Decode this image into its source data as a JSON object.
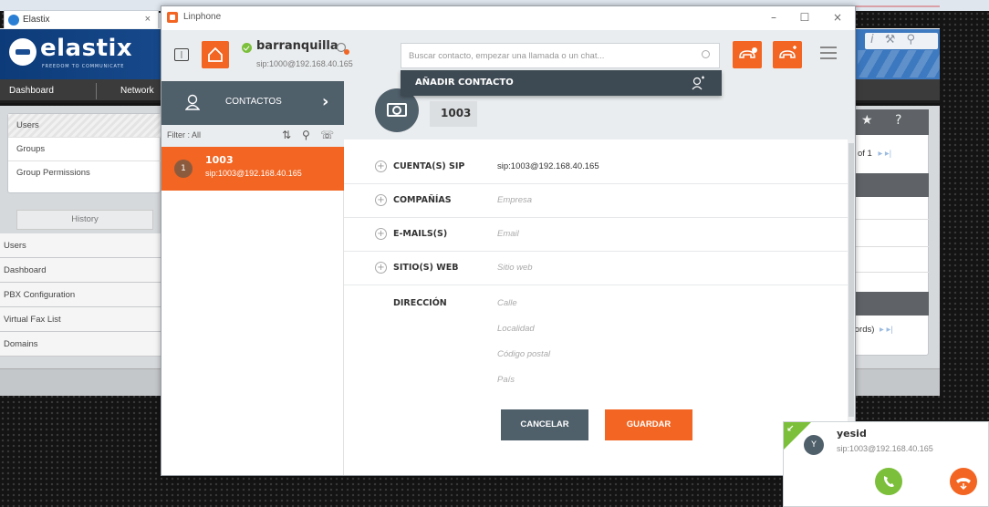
{
  "browser": {
    "tab_title": "Elastix",
    "tab_close": "×"
  },
  "elastix": {
    "logo_text": "elastix",
    "logo_tagline": "FREEDOM TO COMMUNICATE",
    "nav": [
      "Dashboard",
      "Network"
    ],
    "left_menu": [
      "Users",
      "Groups",
      "Group Permissions"
    ],
    "history_label": "History",
    "history_items": [
      "Users",
      "Dashboard",
      "PBX Configuration",
      "Virtual Fax List",
      "Domains"
    ],
    "pager_text": "of 1",
    "records_text": "cords)"
  },
  "linphone": {
    "window_title": "Linphone",
    "user": {
      "name": "barranquilla",
      "sip": "sip:1000@192.168.40.165"
    },
    "search_placeholder": "Buscar contacto, empezar una llamada o un chat...",
    "dropdown_label": "AÑADIR CONTACTO",
    "sidebar": {
      "contacts_label": "CONTACTOS",
      "filter_label": "Filter : All",
      "contacts": [
        {
          "avatar": "1",
          "name": "1003",
          "sip": "sip:1003@192.168.40.165"
        }
      ]
    },
    "detail": {
      "name": "1003",
      "fields": [
        {
          "label": "CUENTA(S) SIP",
          "value": "sip:1003@192.168.40.165",
          "placeholder": ""
        },
        {
          "label": "COMPAÑÍAS",
          "value": "",
          "placeholder": "Empresa"
        },
        {
          "label": "E-MAILS(S)",
          "value": "",
          "placeholder": "Email"
        },
        {
          "label": "SITIO(S) WEB",
          "value": "",
          "placeholder": "Sitio web"
        }
      ],
      "address_label": "DIRECCIÓN",
      "address_placeholders": [
        "Calle",
        "Localidad",
        "Código postal",
        "País"
      ],
      "cancel_label": "CANCELAR",
      "save_label": "GUARDAR"
    }
  },
  "incoming_call": {
    "avatar": "Y",
    "name": "yesid",
    "sip": "sip:1003@192.168.40.165"
  },
  "colors": {
    "accent_orange": "#f26522",
    "slate": "#50606b",
    "online_green": "#7bbf3a",
    "elastix_blue": "#1a4d91"
  }
}
